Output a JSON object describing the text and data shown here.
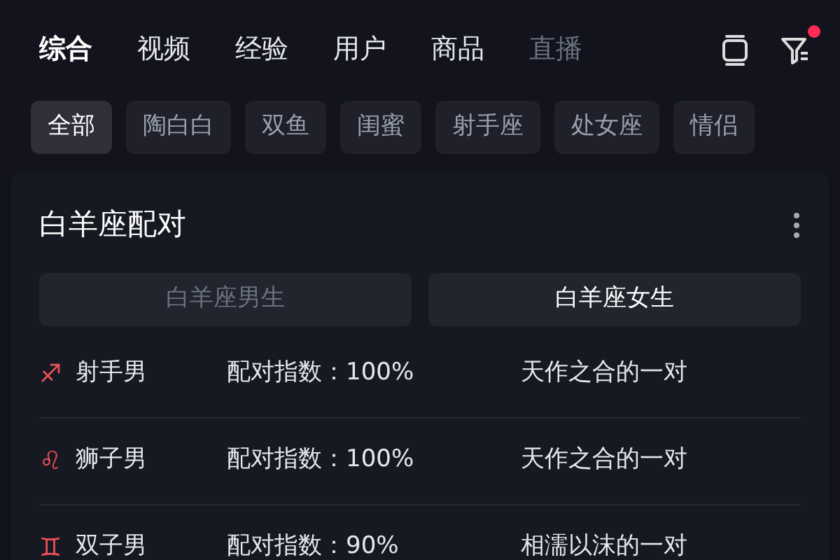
{
  "tabs": [
    {
      "label": "综合",
      "selected": true
    },
    {
      "label": "视频",
      "selected": false
    },
    {
      "label": "经验",
      "selected": false
    },
    {
      "label": "用户",
      "selected": false
    },
    {
      "label": "商品",
      "selected": false
    },
    {
      "label": "直播",
      "selected": false
    }
  ],
  "filter_badge": true,
  "chips": [
    {
      "label": "全部",
      "selected": true
    },
    {
      "label": "陶白白",
      "selected": false
    },
    {
      "label": "双鱼",
      "selected": false
    },
    {
      "label": "闺蜜",
      "selected": false
    },
    {
      "label": "射手座",
      "selected": false
    },
    {
      "label": "处女座",
      "selected": false
    },
    {
      "label": "情侣",
      "selected": false
    }
  ],
  "card": {
    "title": "白羊座配对",
    "segments": [
      {
        "label": "白羊座男生",
        "selected": false
      },
      {
        "label": "白羊座女生",
        "selected": true
      }
    ],
    "rows": [
      {
        "symbol": "♐",
        "name": "射手男",
        "score": "配对指数：100%",
        "description": "天作之合的一对"
      },
      {
        "symbol": "♌",
        "name": "狮子男",
        "score": "配对指数：100%",
        "description": "天作之合的一对"
      },
      {
        "symbol": "♊",
        "name": "双子男",
        "score": "配对指数：90%",
        "description": "相濡以沫的一对"
      }
    ]
  }
}
